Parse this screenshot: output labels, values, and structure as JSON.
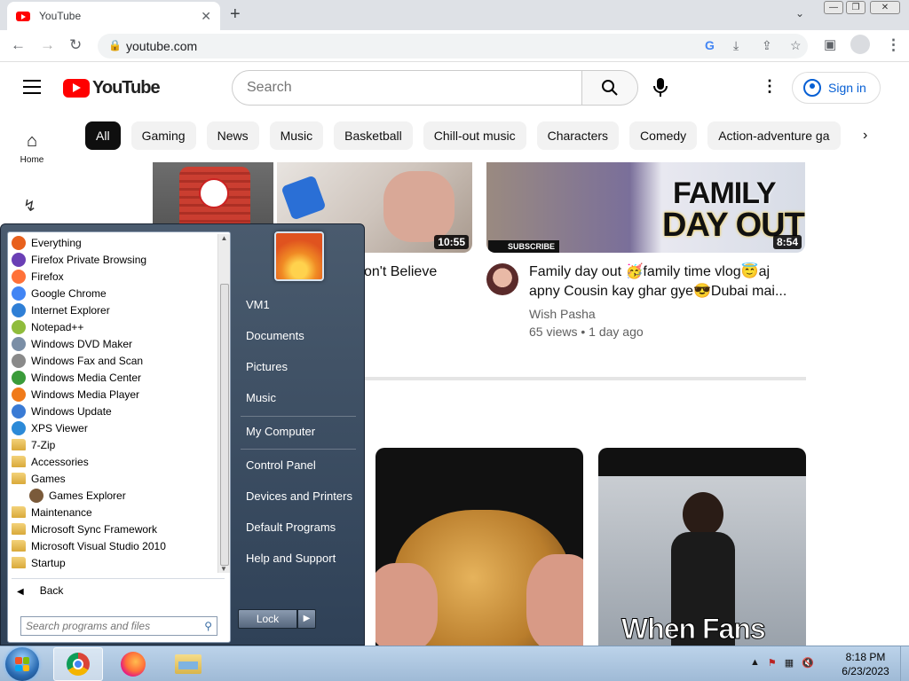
{
  "browser": {
    "tab_title": "YouTube",
    "url": "youtube.com"
  },
  "youtube": {
    "logo_text": "YouTube",
    "search_placeholder": "Search",
    "sign_in": "Sign in",
    "nav_home": "Home",
    "chips": [
      "All",
      "Gaming",
      "News",
      "Music",
      "Basketball",
      "Chill-out music",
      "Characters",
      "Comedy",
      "Action-adventure ga"
    ],
    "videos": [
      {
        "duration": "10:55",
        "title_fragment": "on't Believe"
      },
      {
        "duration": "8:54",
        "badge": "SUBSCRIBE",
        "overlay_text_1": "FAMILY",
        "overlay_text_2": "DAY OUT",
        "title_line1": "Family day out 🥳family time vlog😇aj",
        "title_line2": "apny Cousin kay ghar gye😎Dubai mai...",
        "channel": "Wish Pasha",
        "meta": "65 views • 1 day ago"
      },
      {
        "overlay_text": "When Fans"
      }
    ]
  },
  "start_menu": {
    "programs": [
      {
        "label": "Everything",
        "icon": "search-icon",
        "color": "#e8601c"
      },
      {
        "label": "Firefox Private Browsing",
        "icon": "mask-icon",
        "color": "#6a3fb5"
      },
      {
        "label": "Firefox",
        "icon": "firefox-icon",
        "color": "#ff7139"
      },
      {
        "label": "Google Chrome",
        "icon": "chrome-icon",
        "color": "#4285f4"
      },
      {
        "label": "Internet Explorer",
        "icon": "ie-icon",
        "color": "#2f7fd6"
      },
      {
        "label": "Notepad++",
        "icon": "notepad-icon",
        "color": "#8fbc3c"
      },
      {
        "label": "Windows DVD Maker",
        "icon": "dvd-icon",
        "color": "#7a8ea6"
      },
      {
        "label": "Windows Fax and Scan",
        "icon": "fax-icon",
        "color": "#8a8a8a"
      },
      {
        "label": "Windows Media Center",
        "icon": "media-center-icon",
        "color": "#3a9b3a"
      },
      {
        "label": "Windows Media Player",
        "icon": "media-player-icon",
        "color": "#f07a1a"
      },
      {
        "label": "Windows Update",
        "icon": "update-icon",
        "color": "#3a7bd5"
      },
      {
        "label": "XPS Viewer",
        "icon": "xps-icon",
        "color": "#2c8ad8"
      },
      {
        "label": "7-Zip",
        "icon": "folder-icon",
        "color": ""
      },
      {
        "label": "Accessories",
        "icon": "folder-icon",
        "color": ""
      },
      {
        "label": "Games",
        "icon": "folder-icon",
        "color": ""
      },
      {
        "label": "Games Explorer",
        "icon": "games-explorer-icon",
        "color": "#7a5a3a",
        "sub": true
      },
      {
        "label": "Maintenance",
        "icon": "folder-icon",
        "color": ""
      },
      {
        "label": "Microsoft Sync Framework",
        "icon": "folder-icon",
        "color": ""
      },
      {
        "label": "Microsoft Visual Studio 2010",
        "icon": "folder-icon",
        "color": ""
      },
      {
        "label": "Startup",
        "icon": "folder-icon",
        "color": ""
      }
    ],
    "back": "Back",
    "search_placeholder": "Search programs and files",
    "right": {
      "user": "VM1",
      "documents": "Documents",
      "pictures": "Pictures",
      "music": "Music",
      "computer": "My Computer",
      "control_panel": "Control Panel",
      "devices": "Devices and Printers",
      "default_programs": "Default Programs",
      "help": "Help and Support"
    },
    "lock": "Lock"
  },
  "taskbar": {
    "time": "8:18 PM",
    "date": "6/23/2023"
  }
}
